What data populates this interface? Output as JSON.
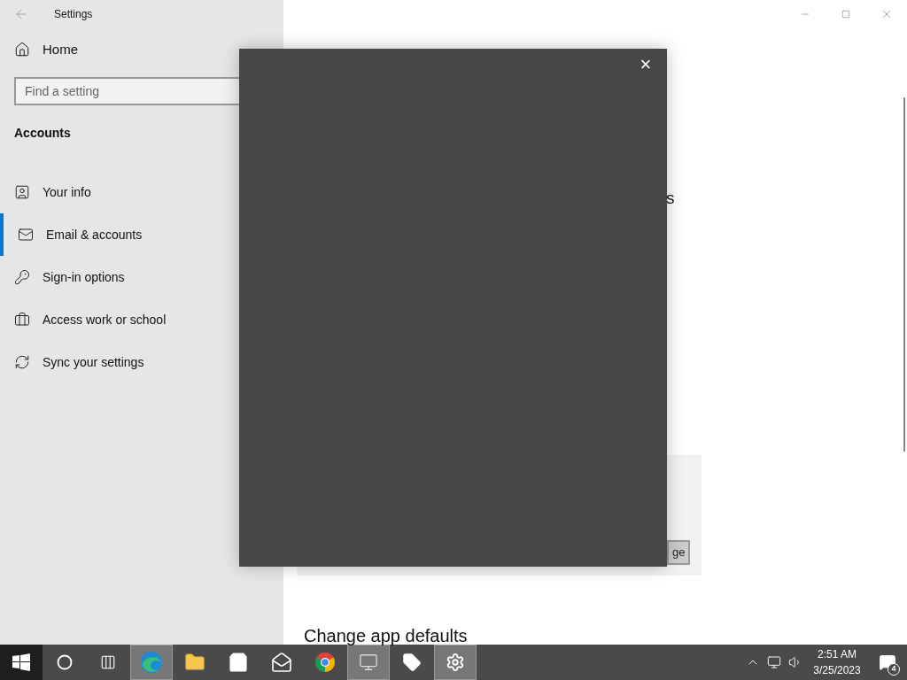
{
  "window": {
    "title": "Settings"
  },
  "sidebar": {
    "home": "Home",
    "search": {
      "placeholder": "Find a setting"
    },
    "section": "Accounts",
    "items": [
      {
        "kind": "info",
        "label": "Your info",
        "selected": false
      },
      {
        "kind": "email",
        "label": "Email & accounts",
        "selected": true
      },
      {
        "kind": "key",
        "label": "Sign-in options",
        "selected": false
      },
      {
        "kind": "work",
        "label": "Access work or school",
        "selected": false
      },
      {
        "kind": "sync",
        "label": "Sync your settings",
        "selected": false
      }
    ]
  },
  "content": {
    "partial_text": "s",
    "panel": {
      "button": "ge"
    },
    "heading": "Change app defaults"
  },
  "dialog": {
    "close": "×"
  },
  "taskbar": {
    "apps": [
      {
        "kind": "start",
        "active": false
      },
      {
        "kind": "search",
        "active": false
      },
      {
        "kind": "taskview",
        "active": false
      },
      {
        "kind": "edge",
        "active": true
      },
      {
        "kind": "explorer",
        "active": false
      },
      {
        "kind": "store",
        "active": false
      },
      {
        "kind": "mail",
        "active": false
      },
      {
        "kind": "chrome",
        "active": false
      },
      {
        "kind": "monitor",
        "active": true
      },
      {
        "kind": "tag",
        "active": false
      },
      {
        "kind": "settings",
        "active": true
      }
    ],
    "time": "2:51 AM",
    "date": "3/25/2023",
    "notifications": "4"
  }
}
